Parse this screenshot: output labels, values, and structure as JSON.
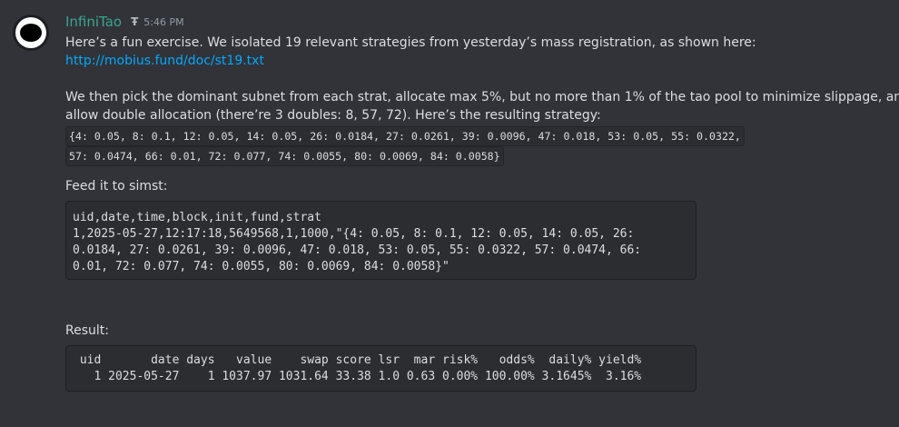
{
  "message": {
    "username": "InfiniTao",
    "role_badge": "Ŧ",
    "timestamp": "5:46 PM",
    "p1": "Here’s a fun exercise. We isolated 19 relevant strategies from yesterday’s mass registration, as shown here:",
    "link": "http://mobius.fund/doc/st19.txt",
    "p2_line1": "We then pick the dominant subnet from each strat, allocate max 5%, but no more than 1% of the tao pool to minimize slippage, and",
    "p2_line2": "allow double allocation (there’re 3 doubles: 8, 57, 72). Here’s the resulting strategy:",
    "strategy_line1": "{4: 0.05, 8: 0.1, 12: 0.05, 14: 0.05, 26: 0.0184, 27: 0.0261, 39: 0.0096, 47: 0.018, 53: 0.05, 55: 0.0322,",
    "strategy_line2": "57: 0.0474, 66: 0.01, 72: 0.077, 74: 0.0055, 80: 0.0069, 84: 0.0058}",
    "p3": "Feed it to simst:",
    "code1": "uid,date,time,block,init,fund,strat\n1,2025-05-27,12:17:18,5649568,1,1000,\"{4: 0.05, 8: 0.1, 12: 0.05, 14: 0.05, 26:\n0.0184, 27: 0.0261, 39: 0.0096, 47: 0.018, 53: 0.05, 55: 0.0322, 57: 0.0474, 66:\n0.01, 72: 0.077, 74: 0.0055, 80: 0.0069, 84: 0.0058}\"",
    "p4": "Result:",
    "code2": " uid       date days   value    swap score lsr  mar risk%   odds%  daily% yield%\n   1 2025-05-27    1 1037.97 1031.64 33.38 1.0 0.63 0.00% 100.00% 3.1645%  3.16%"
  },
  "colors": {
    "background": "#313338",
    "username": "#3aa58f",
    "link": "#00a8fc",
    "code_bg": "#2b2d31"
  }
}
